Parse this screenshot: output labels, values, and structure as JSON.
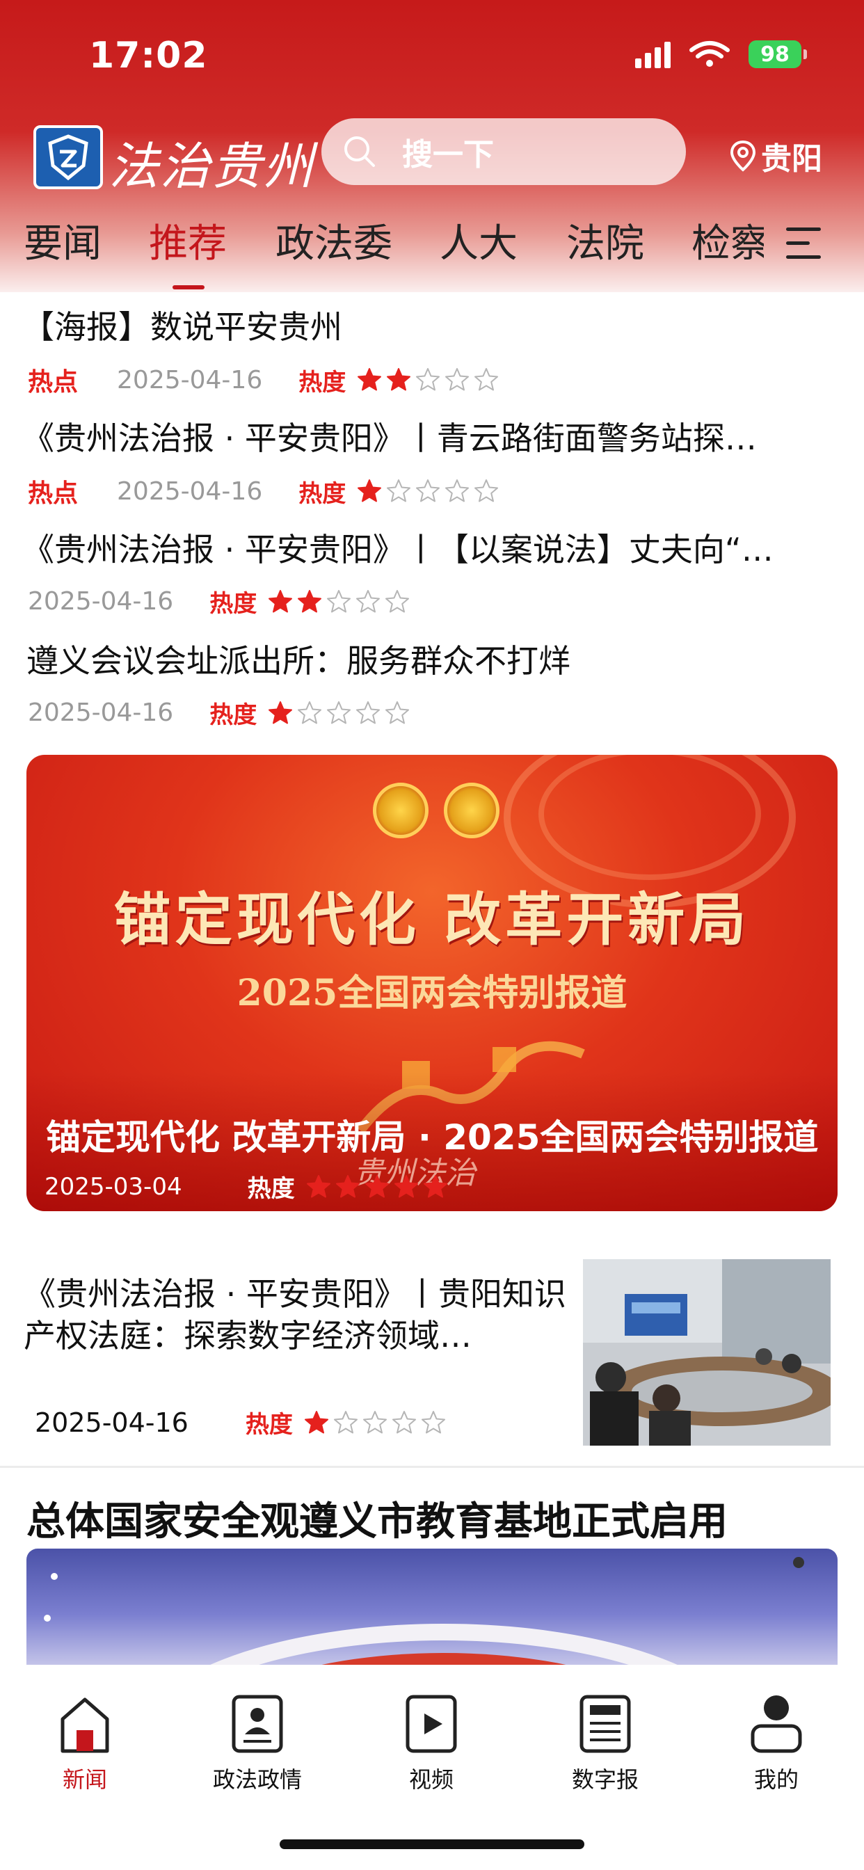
{
  "status": {
    "time": "17:02",
    "battery": "98"
  },
  "header": {
    "logo_text": "法治贵州",
    "search_placeholder": "搜一下",
    "location": "贵阳"
  },
  "tabs": [
    "要闻",
    "推荐",
    "政法委",
    "人大",
    "法院",
    "检察"
  ],
  "active_tab": "推荐",
  "news": [
    {
      "title": "【海报】数说平安贵州",
      "tag": "热点",
      "date": "2025-04-16",
      "heat_label": "热度",
      "heat": 2
    },
    {
      "title": "《贵州法治报 · 平安贵阳》丨青云路街面警务站探…",
      "tag": "热点",
      "date": "2025-04-16",
      "heat_label": "热度",
      "heat": 1
    },
    {
      "title": "《贵州法治报 · 平安贵阳》丨【以案说法】丈夫向“…",
      "tag": "",
      "date": "2025-04-16",
      "heat_label": "热度",
      "heat": 2
    },
    {
      "title": "遵义会议会址派出所：服务群众不打烊",
      "tag": "",
      "date": "2025-04-16",
      "heat_label": "热度",
      "heat": 1
    }
  ],
  "banner": {
    "headline": "锚定现代化 改革开新局",
    "subheadline": "2025全国两会特别报道",
    "caption": "锚定现代化 改革开新局 · 2025全国两会特别报道",
    "date": "2025-03-04",
    "heat_label": "热度",
    "heat": 5,
    "watermark": "贵州法治"
  },
  "article": {
    "title": "《贵州法治报 · 平安贵阳》丨贵阳知识产权法庭：探索数字经济领域…",
    "date": "2025-04-16",
    "heat_label": "热度",
    "heat": 1
  },
  "feature": {
    "title": "总体国家安全观遵义市教育基地正式启用"
  },
  "bottom_nav": [
    {
      "label": "新闻",
      "icon": "home-icon",
      "active": true
    },
    {
      "label": "政法政情",
      "icon": "id-card-icon",
      "active": false
    },
    {
      "label": "视频",
      "icon": "video-play-icon",
      "active": false
    },
    {
      "label": "数字报",
      "icon": "newspaper-icon",
      "active": false
    },
    {
      "label": "我的",
      "icon": "user-icon",
      "active": false
    }
  ],
  "colors": {
    "brand_red": "#c4161c",
    "hot_red": "#e5211d",
    "meta_gray": "#999999"
  }
}
